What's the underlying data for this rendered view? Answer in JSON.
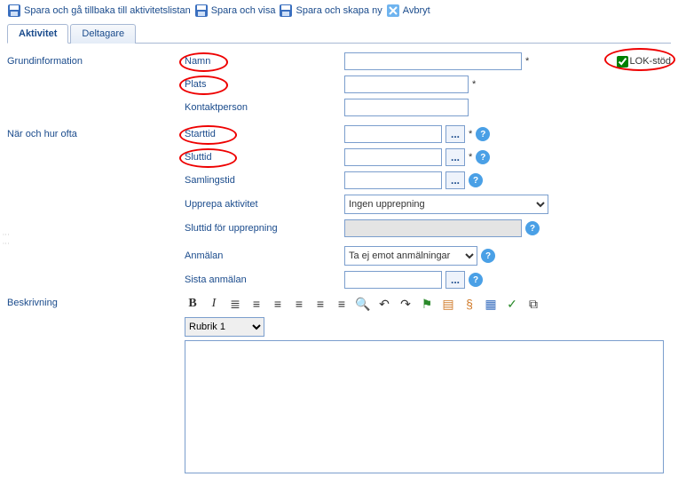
{
  "toolbar": {
    "save_back": "Spara och gå tillbaka till aktivitetslistan",
    "save_show": "Spara och visa",
    "save_new": "Spara och skapa ny",
    "cancel": "Avbryt"
  },
  "tabs": {
    "activity": "Aktivitet",
    "participants": "Deltagare"
  },
  "lok": {
    "label": "LOK-stöd",
    "checked": true
  },
  "sections": {
    "basic": "Grundinformation",
    "when": "När och hur ofta",
    "description": "Beskrivning"
  },
  "labels": {
    "name": "Namn",
    "place": "Plats",
    "contact": "Kontaktperson",
    "start": "Starttid",
    "end": "Sluttid",
    "gather": "Samlingstid",
    "repeat": "Upprepa aktivitet",
    "repeat_end": "Sluttid för upprepning",
    "signup": "Anmälan",
    "last_signup": "Sista anmälan"
  },
  "fields": {
    "name": "",
    "place": "",
    "contact": "",
    "start": "",
    "end": "",
    "gather": "",
    "repeat_end": "",
    "last_signup": ""
  },
  "dropdowns": {
    "repeat_options": [
      "Ingen upprepning"
    ],
    "repeat_selected": "Ingen upprepning",
    "signup_options": [
      "Ta ej emot anmälningar"
    ],
    "signup_selected": "Ta ej emot anmälningar",
    "format_options": [
      "Rubrik 1"
    ],
    "format_selected": "Rubrik 1"
  },
  "symbols": {
    "required": "*",
    "ellipsis": "...",
    "help": "?"
  },
  "editor_icons": {
    "bold": "B",
    "italic": "I",
    "ol": "≣",
    "ul": "≡",
    "al": "≡",
    "ac": "≡",
    "ar": "≡",
    "aj": "≡",
    "find": "🔍",
    "undo": "↶",
    "redo": "↷",
    "flag": "⚑",
    "doc": "▤",
    "link": "§",
    "table": "▦",
    "check": "✓",
    "copy": "⧉"
  }
}
